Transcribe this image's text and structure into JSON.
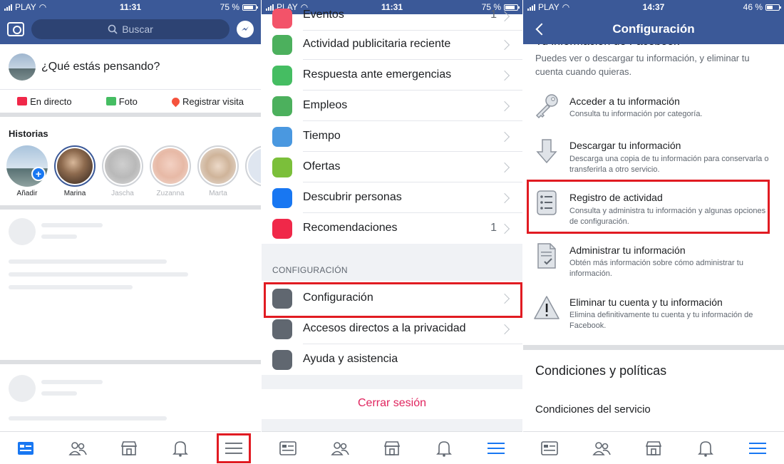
{
  "panel1": {
    "status": {
      "carrier": "PLAY",
      "time": "11:31",
      "battery": "75 %",
      "battery_level": 0.75
    },
    "search": {
      "placeholder": "Buscar"
    },
    "composer": {
      "prompt": "¿Qué estás pensando?"
    },
    "actions": {
      "live": "En directo",
      "photo": "Foto",
      "checkin": "Registrar visita"
    },
    "stories": {
      "title": "Historias",
      "items": [
        {
          "label": "Añadir"
        },
        {
          "label": "Marina"
        },
        {
          "label": "Jascha"
        },
        {
          "label": "Zuzanna"
        },
        {
          "label": "Marta"
        }
      ]
    }
  },
  "panel2": {
    "status": {
      "carrier": "PLAY",
      "time": "11:31",
      "battery": "75 %",
      "battery_level": 0.75
    },
    "menu": {
      "events": "Eventos",
      "events_count": "1",
      "ads_activity": "Actividad publicitaria reciente",
      "emergency": "Respuesta ante emergencias",
      "jobs": "Empleos",
      "weather": "Tiempo",
      "offers": "Ofertas",
      "discover": "Descubrir personas",
      "recommendations": "Recomendaciones",
      "recommendations_count": "1"
    },
    "section_label": "CONFIGURACIÓN",
    "settings": {
      "config": "Configuración",
      "privacy": "Accesos directos a la privacidad",
      "help": "Ayuda y asistencia"
    },
    "logout": "Cerrar sesión"
  },
  "panel3": {
    "status": {
      "carrier": "PLAY",
      "time": "14:37",
      "battery": "46 %",
      "battery_level": 0.46
    },
    "header": "Configuración",
    "cut_title": "Tu información de Facebook",
    "intro": "Puedes ver o descargar tu información, y eliminar tu cuenta cuando quieras.",
    "options": [
      {
        "title": "Acceder a tu información",
        "desc": "Consulta tu información por categoría."
      },
      {
        "title": "Descargar tu información",
        "desc": "Descarga una copia de tu información para conservarla o transferirla a otro servicio."
      },
      {
        "title": "Registro de actividad",
        "desc": "Consulta y administra tu información y algunas opciones de configuración."
      },
      {
        "title": "Administrar tu información",
        "desc": "Obtén más información sobre cómo administrar tu información."
      },
      {
        "title": "Eliminar tu cuenta y tu información",
        "desc": "Elimina definitivamente tu cuenta y tu información de Facebook."
      }
    ],
    "conditions_title": "Condiciones y políticas",
    "conditions_item": "Condiciones del servicio"
  },
  "colors": {
    "brand": "#3b5998",
    "highlight": "#e11b22",
    "logout": "#e0245e",
    "active_tab": "#1877f2"
  }
}
